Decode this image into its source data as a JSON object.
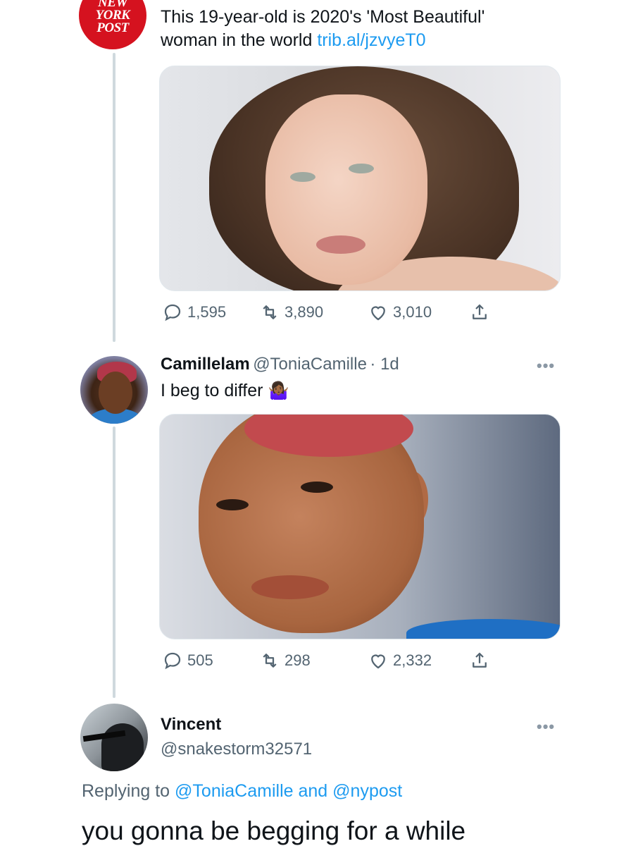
{
  "tweet1": {
    "avatar_lines": [
      "NEW",
      "YORK",
      "POST"
    ],
    "text": "This 19-year-old is 2020's 'Most Beautiful' woman in the world",
    "text_line1": "This 19-year-old is 2020's 'Most Beautiful'",
    "text_line2_prefix": "woman in the world",
    "link": "trib.al/jzvyeT0",
    "replies": "1,595",
    "retweets": "3,890",
    "likes": "3,010"
  },
  "tweet2": {
    "name": "Camillelam",
    "handle": "@ToniaCamille",
    "time": "· 1d",
    "text": "I beg to differ",
    "emoji": "🤷🏾‍♀️",
    "replies": "505",
    "retweets": "298",
    "likes": "2,332",
    "more": "•••"
  },
  "tweet3": {
    "name": "Vincent",
    "handle": "@snakestorm32571",
    "more": "•••",
    "replying_prefix": "Replying to",
    "replying_user1": "@ToniaCamille",
    "replying_and": "and",
    "replying_user2": "@nypost",
    "text": "you gonna be begging for a while"
  },
  "colors": {
    "link": "#1d9bf0",
    "secondary_text": "#536471",
    "nypost_red": "#d5121f",
    "thread_line": "#cfd9de"
  },
  "icons": [
    "reply-icon",
    "retweet-icon",
    "like-icon",
    "share-icon",
    "more-icon"
  ]
}
